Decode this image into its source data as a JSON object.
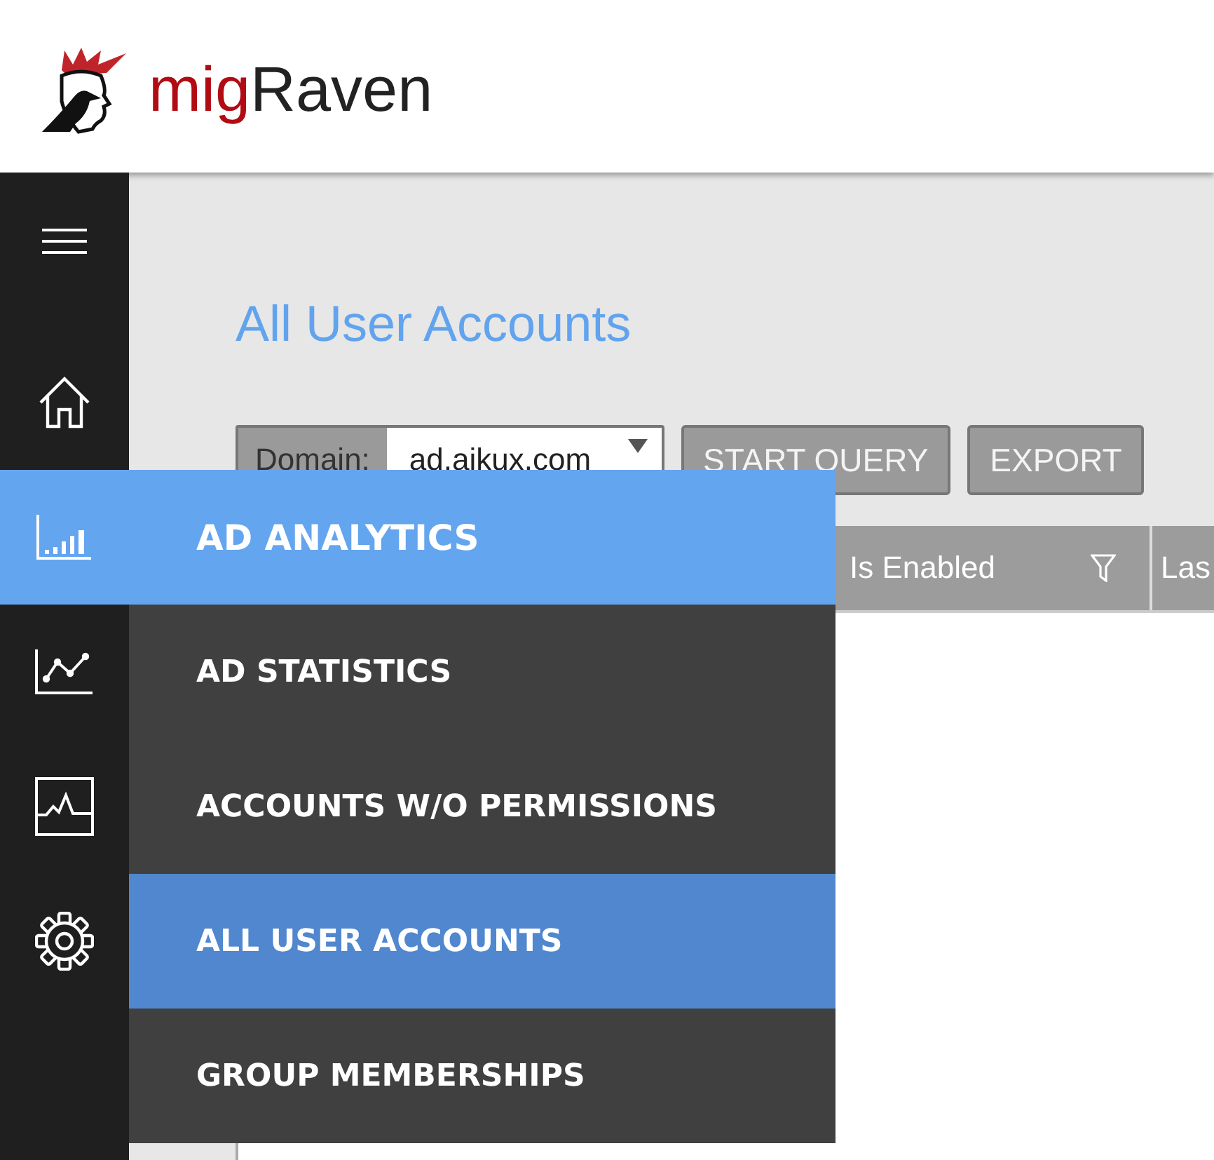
{
  "brand": {
    "prefix": "mig",
    "name": "Raven"
  },
  "sidebar": {
    "items": [
      {
        "kind": "menu",
        "expanded": false
      },
      {
        "kind": "home",
        "expanded": false
      },
      {
        "kind": "bar-chart",
        "expanded": true,
        "label": "AD ANALYTICS",
        "children": [
          {
            "label": "AD STATISTICS",
            "selected": false
          },
          {
            "label": "ACCOUNTS W/O PERMISSIONS",
            "selected": false
          },
          {
            "label": "ALL USER ACCOUNTS",
            "selected": true
          },
          {
            "label": "GROUP MEMBERSHIPS",
            "selected": false
          }
        ]
      },
      {
        "kind": "line-chart",
        "expanded": false
      },
      {
        "kind": "activity",
        "expanded": false
      },
      {
        "kind": "settings",
        "expanded": false
      }
    ]
  },
  "page": {
    "title": "All User Accounts"
  },
  "toolbar": {
    "domain_label": "Domain:",
    "domain_value": "ad.aikux.com",
    "buttons": [
      "START QUERY",
      "EXPORT"
    ]
  },
  "table": {
    "columns": [
      {
        "label": "Is Enabled",
        "filter": true
      },
      {
        "label": "Las",
        "filter": false
      }
    ]
  }
}
